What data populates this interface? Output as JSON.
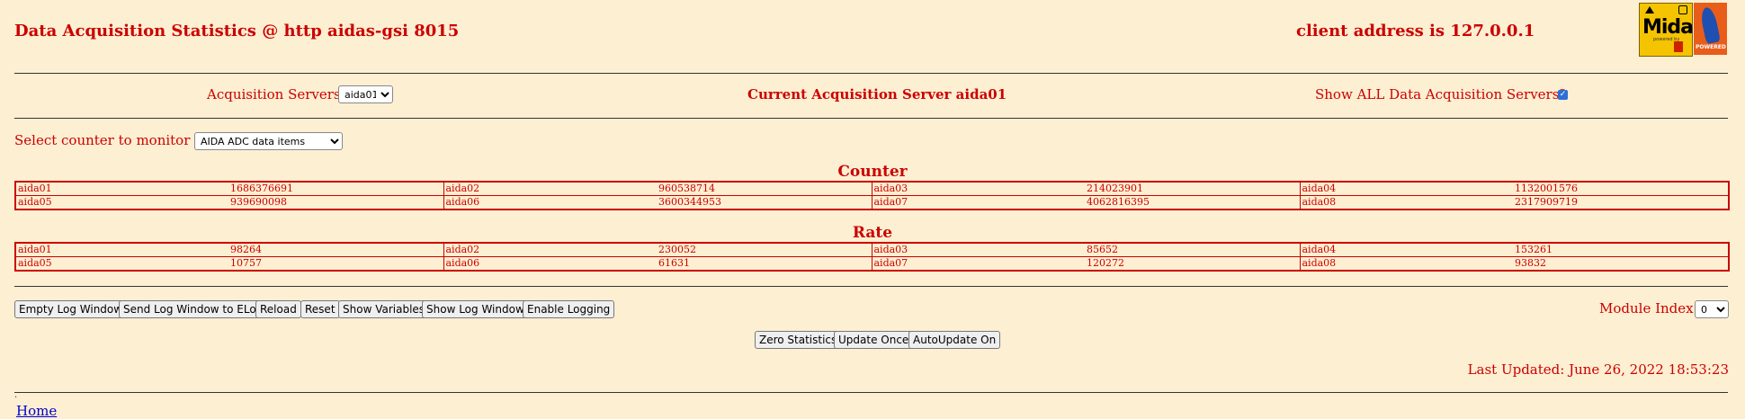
{
  "header": {
    "title": "Data Acquisition Statistics @ http aidas-gsi 8015",
    "client": "client address is 127.0.0.1",
    "logo_midas_text": "Midas",
    "logo_midas_sub": "powered by",
    "logo_tcl_text": "POWERED"
  },
  "servers": {
    "label": "Acquisition Servers",
    "selected": "aida01",
    "current": "Current Acquisition Server aida01",
    "show_all_label": "Show ALL Data Acquisition Servers?",
    "show_all_checked": true
  },
  "counter_select": {
    "label": "Select counter to monitor",
    "selected": "AIDA ADC data items"
  },
  "counter_table": {
    "title": "Counter",
    "rows": [
      [
        [
          "aida01",
          "1686376691"
        ],
        [
          "aida02",
          "960538714"
        ],
        [
          "aida03",
          "214023901"
        ],
        [
          "aida04",
          "1132001576"
        ]
      ],
      [
        [
          "aida05",
          "939690098"
        ],
        [
          "aida06",
          "3600344953"
        ],
        [
          "aida07",
          "4062816395"
        ],
        [
          "aida08",
          "2317909719"
        ]
      ]
    ]
  },
  "rate_table": {
    "title": "Rate",
    "rows": [
      [
        [
          "aida01",
          "98264"
        ],
        [
          "aida02",
          "230052"
        ],
        [
          "aida03",
          "85652"
        ],
        [
          "aida04",
          "153261"
        ]
      ],
      [
        [
          "aida05",
          "10757"
        ],
        [
          "aida06",
          "61631"
        ],
        [
          "aida07",
          "120272"
        ],
        [
          "aida08",
          "93832"
        ]
      ]
    ]
  },
  "buttons": {
    "empty_log": "Empty Log Window",
    "send_log": "Send Log Window to ELog",
    "reload": "Reload",
    "reset": "Reset",
    "show_vars": "Show Variables",
    "show_log": "Show Log Window",
    "enable_logging": "Enable Logging",
    "zero_stats": "Zero Statistics",
    "update_once": "Update Once",
    "autoupdate": "AutoUpdate On"
  },
  "module_index": {
    "label": "Module Index",
    "selected": "0"
  },
  "last_updated": "Last Updated: June 26, 2022 18:53:23",
  "footer": {
    "dot": ".",
    "home": "Home"
  }
}
